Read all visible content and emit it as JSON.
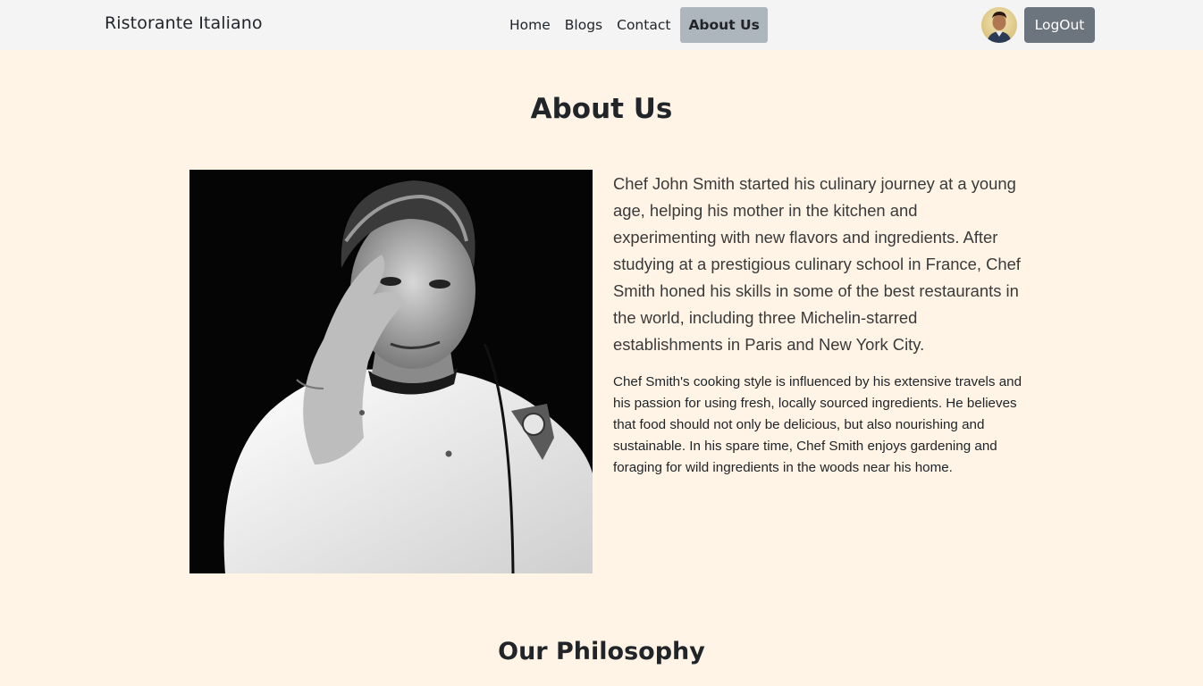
{
  "navbar": {
    "brand": "Ristorante Italiano",
    "links": [
      "Home",
      "Blogs",
      "Contact",
      "About Us"
    ],
    "active_link": "About Us",
    "logout_label": "LogOut"
  },
  "about": {
    "title": "About Us",
    "lead": "Chef John Smith started his culinary journey at a young age, helping his mother in the kitchen and experimenting with new flavors and ingredients. After studying at a prestigious culinary school in France, Chef Smith honed his skills in some of the best restaurants in the world, including three Michelin-starred establishments in Paris and New York City.",
    "body": "Chef Smith's cooking style is influenced by his extensive travels and his passion for using fresh, locally sourced ingredients. He believes that food should not only be delicious, but also nourishing and sustainable. In his spare time, Chef Smith enjoys gardening and foraging for wild ingredients in the woods near his home."
  },
  "philosophy": {
    "title": "Our Philosophy"
  },
  "colors": {
    "page_bg": "#fff4e6",
    "navbar_bg": "#f4f4f4",
    "active_link_bg": "#adb5bd",
    "logout_bg": "#6c757d"
  }
}
